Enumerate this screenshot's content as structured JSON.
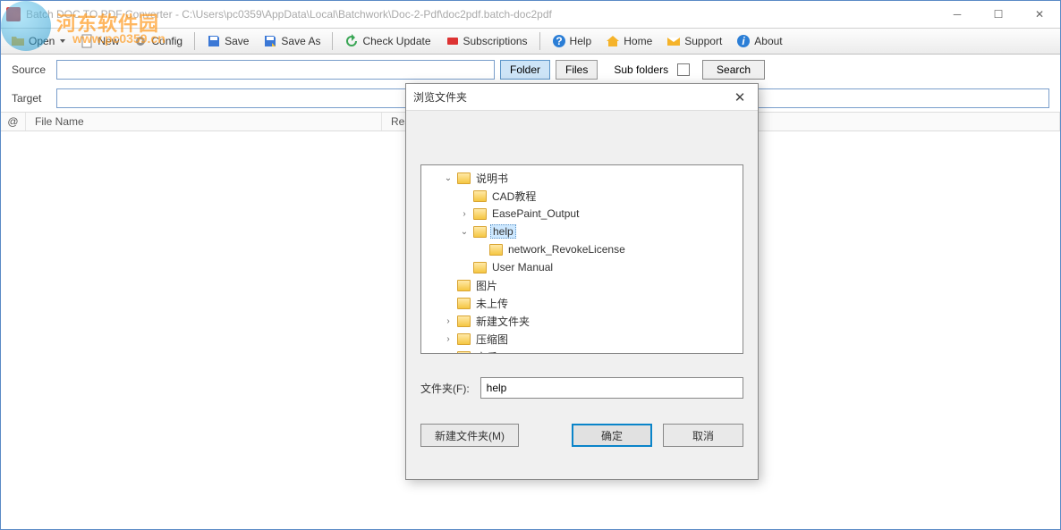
{
  "window": {
    "title": "Batch DOC TO PDF Converter - C:\\Users\\pc0359\\AppData\\Local\\Batchwork\\Doc-2-Pdf\\doc2pdf.batch-doc2pdf"
  },
  "toolbar": {
    "open": "Open",
    "new": "New",
    "config": "Config",
    "save": "Save",
    "saveas": "Save As",
    "check_update": "Check Update",
    "subscriptions": "Subscriptions",
    "help": "Help",
    "home": "Home",
    "support": "Support",
    "about": "About"
  },
  "paths": {
    "source_label": "Source",
    "source_value": "",
    "target_label": "Target",
    "target_value": "",
    "folder_btn": "Folder",
    "files_btn": "Files",
    "subfolders_label": "Sub folders",
    "search_btn": "Search"
  },
  "table": {
    "col_at": "@",
    "col_filename": "File Name",
    "col_result": "Result"
  },
  "dialog": {
    "title": "浏览文件夹",
    "tree": [
      {
        "label": "说明书",
        "indent": 0,
        "caret": "open"
      },
      {
        "label": "CAD教程",
        "indent": 1,
        "caret": "none"
      },
      {
        "label": "EasePaint_Output",
        "indent": 1,
        "caret": "closed"
      },
      {
        "label": "help",
        "indent": 1,
        "caret": "open",
        "selected": true
      },
      {
        "label": "network_RevokeLicense",
        "indent": 2,
        "caret": "none"
      },
      {
        "label": "User Manual",
        "indent": 1,
        "caret": "none"
      },
      {
        "label": "图片",
        "indent": 0,
        "caret": "none"
      },
      {
        "label": "未上传",
        "indent": 0,
        "caret": "none"
      },
      {
        "label": "新建文件夹",
        "indent": 0,
        "caret": "closed"
      },
      {
        "label": "压缩图",
        "indent": 0,
        "caret": "closed"
      },
      {
        "label": "音乐",
        "indent": 0,
        "caret": "closed"
      }
    ],
    "folder_label": "文件夹(F):",
    "folder_value": "help",
    "new_folder_btn": "新建文件夹(M)",
    "ok_btn": "确定",
    "cancel_btn": "取消"
  },
  "watermark": {
    "line1": "河东软件园",
    "line2": "www.pc0359.cn"
  }
}
